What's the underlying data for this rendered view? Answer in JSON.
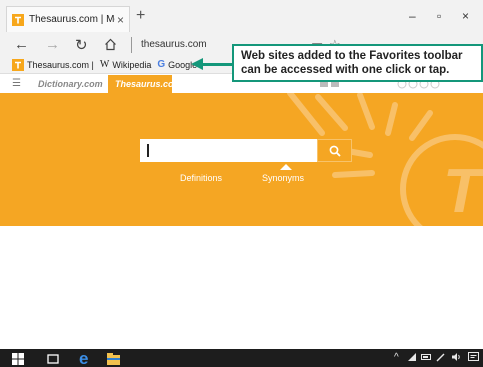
{
  "browser": {
    "tab_title": "Thesaurus.com | Meanin",
    "tab_close": "×",
    "new_tab": "+",
    "url": "thesaurus.com",
    "window_controls": [
      "–",
      "▫",
      "×"
    ]
  },
  "favorites_bar": {
    "items": [
      {
        "label": "Thesaurus.com |",
        "icon": "thesaurus-favicon"
      },
      {
        "label": "Wikipedia",
        "icon_text": "W"
      },
      {
        "label": "Google",
        "icon_text": "G"
      }
    ]
  },
  "callout": {
    "line1": "Web sites added to the Favorites toolbar",
    "line2": "can be accessed with one click or tap.",
    "color": "#14977a"
  },
  "site": {
    "nav_tabs": [
      "Dictionary.com",
      "Thesaurus.com"
    ],
    "search_value": "",
    "links": [
      "Definitions",
      "Synonyms"
    ],
    "accent_color": "#f5a623"
  }
}
